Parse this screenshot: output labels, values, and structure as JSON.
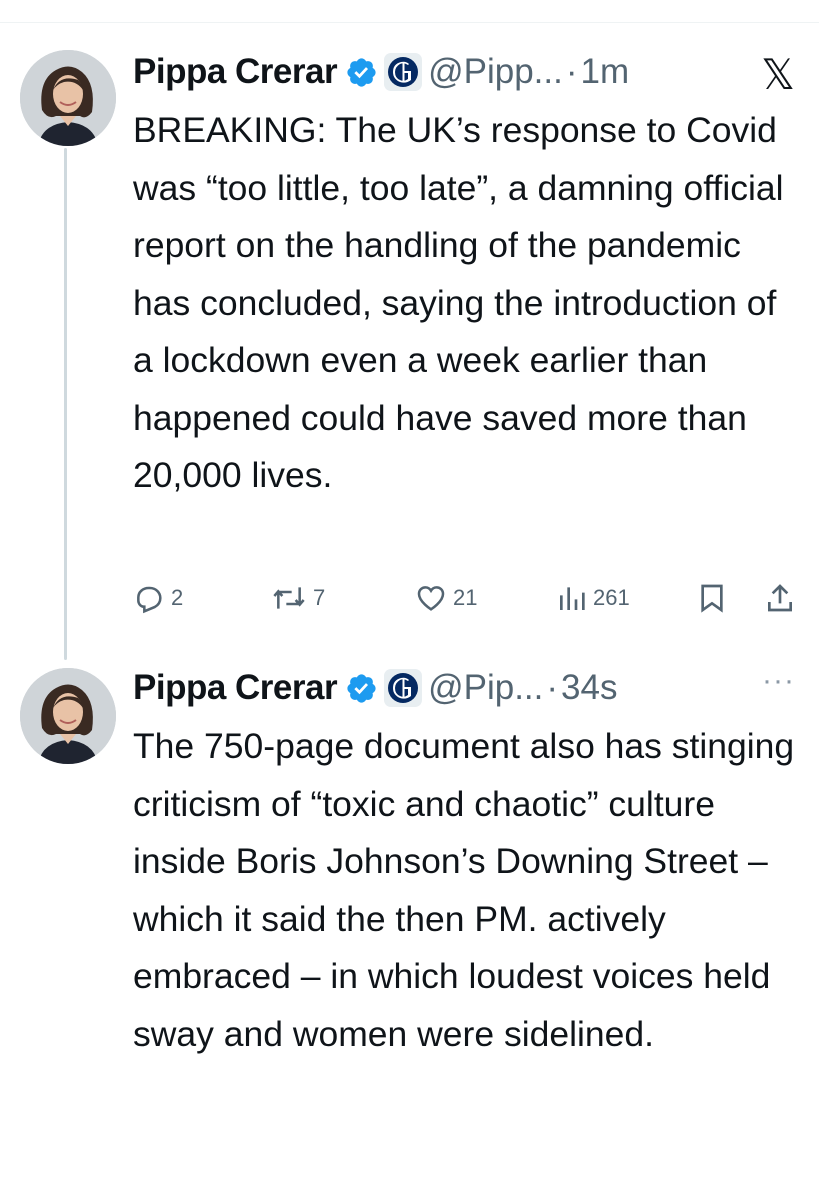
{
  "tweets": [
    {
      "author": "Pippa Crerar",
      "handle": "@Pipp...",
      "separator": "·",
      "time": "1m",
      "text": "BREAKING: The UK’s response to Covid was “too little, too late”, a damning official report on the handling of the pandemic has concluded, saying the introduction of a lockdown even a week earlier than happened could have saved more than 20,000 lives.",
      "stats": {
        "replies": "2",
        "reposts": "7",
        "likes": "21",
        "views": "261"
      }
    },
    {
      "author": "Pippa Crerar",
      "handle": "@Pip...",
      "separator": "·",
      "time": "34s",
      "text": "The 750-page document also has stinging criticism of “toxic and chaotic” culture inside Boris Johnson’s Downing Street – which it said the then PM. actively embraced – in which loudest voices held sway and women were sidelined."
    }
  ],
  "icons": {
    "verified": "verified-badge-icon",
    "affiliate": "guardian-logo-icon",
    "platform": "x-logo-icon",
    "more": "more-icon",
    "reply": "reply-icon",
    "repost": "repost-icon",
    "like": "like-icon",
    "views": "views-icon",
    "bookmark": "bookmark-icon",
    "share": "share-icon"
  },
  "colors": {
    "verified": "#1d9bf0",
    "secondary_text": "#536471",
    "text": "#0f1419"
  }
}
